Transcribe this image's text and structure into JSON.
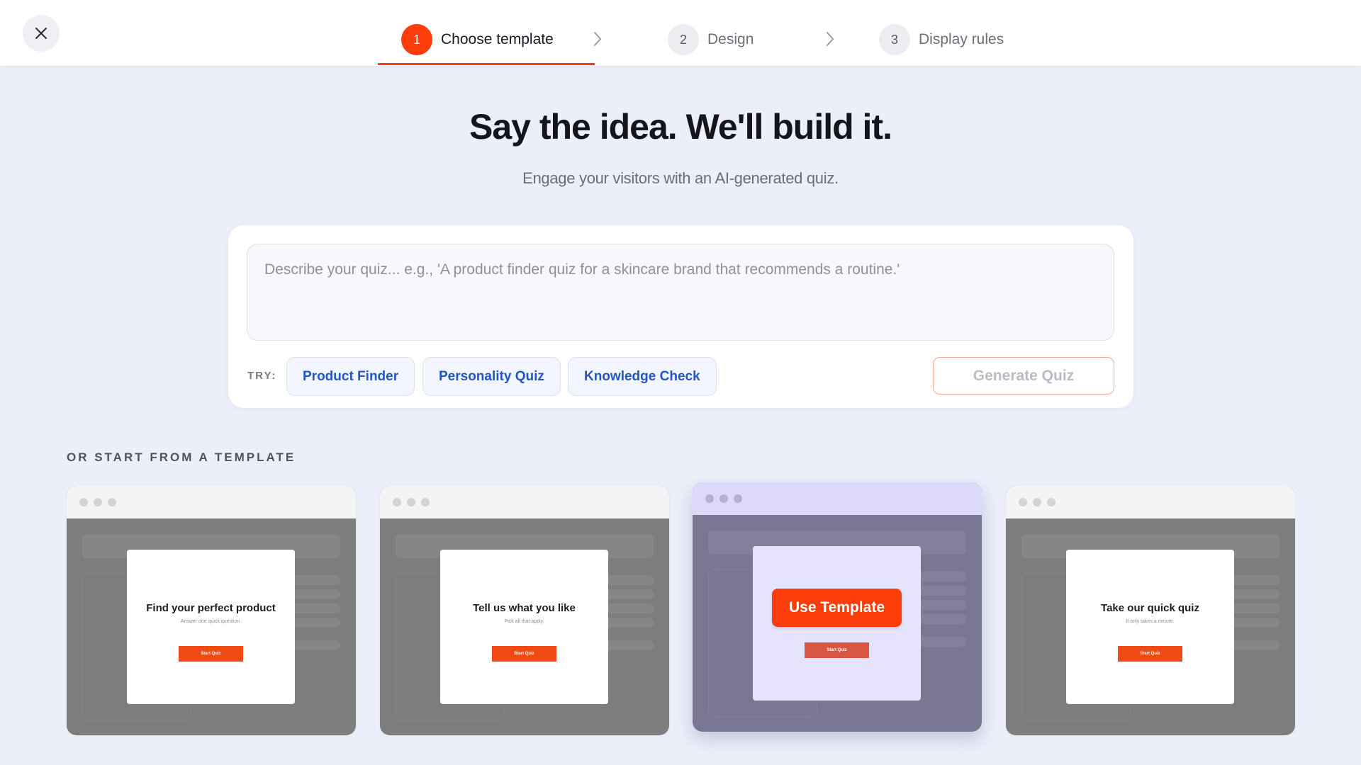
{
  "stepper": {
    "steps": [
      {
        "number": "1",
        "label": "Choose template",
        "active": true
      },
      {
        "number": "2",
        "label": "Design",
        "active": false
      },
      {
        "number": "3",
        "label": "Display rules",
        "active": false
      }
    ]
  },
  "hero": {
    "title": "Say the idea. We'll build it.",
    "subtitle": "Engage your visitors with an AI-generated quiz."
  },
  "prompt": {
    "placeholder": "Describe your quiz... e.g., 'A product finder quiz for a skincare brand that recommends a routine.'",
    "value": "",
    "try_label": "TRY:",
    "chips": [
      "Product Finder",
      "Personality Quiz",
      "Knowledge Check"
    ],
    "generate_label": "Generate Quiz"
  },
  "templates": {
    "section_label": "OR START FROM A TEMPLATE",
    "use_template_label": "Use Template",
    "items": [
      {
        "title": "Find your perfect product",
        "subtitle": "Answer one quick question.",
        "button": "Start Quiz"
      },
      {
        "title": "Tell us what you like",
        "subtitle": "Pick all that apply.",
        "button": "Start Quiz"
      },
      {
        "title": "",
        "subtitle": "",
        "button": "Start Quiz"
      },
      {
        "title": "Take our quick quiz",
        "subtitle": "It only takes a minute.",
        "button": "Start Quiz"
      }
    ]
  },
  "colors": {
    "accent": "#fb3d0c",
    "background": "#eceef9",
    "chip_text": "#2156c3"
  },
  "icons": {
    "close": "close-icon",
    "step_separator": "chevron-right-icon"
  }
}
